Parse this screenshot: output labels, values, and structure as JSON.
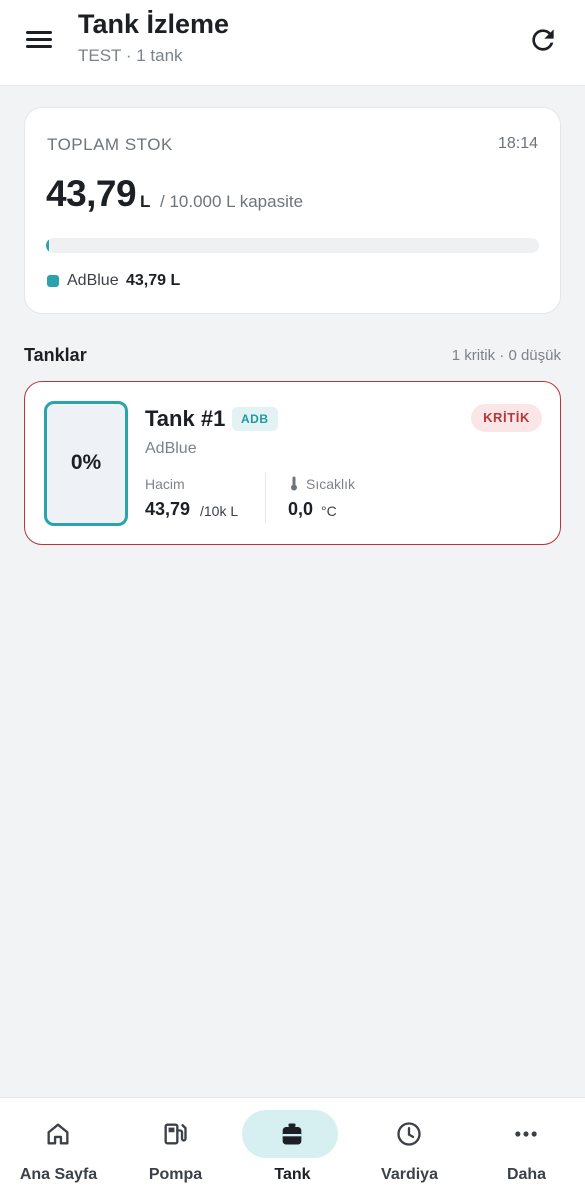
{
  "header": {
    "title": "Tank İzleme",
    "subtitle": "TEST · 1 tank",
    "menu_icon": "menu-icon",
    "refresh_icon": "refresh-icon"
  },
  "stock": {
    "label": "TOPLAM STOK",
    "time": "18:14",
    "value": "43,79",
    "unit": "L",
    "capacity": "/ 10.000 L kapasite",
    "fill_fraction": 0.0044,
    "legend": {
      "name": "AdBlue",
      "value": "43,79 L",
      "color": "#2aa3ad"
    }
  },
  "tanks_section": {
    "title": "Tanklar",
    "meta": "1 kritik · 0 düşük"
  },
  "tanks": [
    {
      "name": "Tank #1",
      "tag": "ADB",
      "status": "KRİTİK",
      "product": "AdBlue",
      "fill_percent_label": "0%",
      "fill_fraction": 0.0,
      "volume_label": "Hacim",
      "volume_value": "43,79",
      "volume_unit": "/10k L",
      "temp_label": "Sıcaklık",
      "temp_value": "0,0",
      "temp_unit": "°C",
      "temp_icon": "thermometer-icon",
      "border_color": "#b7353b"
    }
  ],
  "nav": {
    "items": [
      {
        "label": "Ana Sayfa",
        "icon": "home-icon",
        "active": false
      },
      {
        "label": "Pompa",
        "icon": "fuel-pump-icon",
        "active": false
      },
      {
        "label": "Tank",
        "icon": "tank-icon",
        "active": true
      },
      {
        "label": "Vardiya",
        "icon": "clock-icon",
        "active": false
      },
      {
        "label": "Daha",
        "icon": "more-icon",
        "active": false
      }
    ]
  },
  "colors": {
    "accent": "#2aa3ad",
    "critical": "#b7353b",
    "background": "#f2f3f5"
  }
}
